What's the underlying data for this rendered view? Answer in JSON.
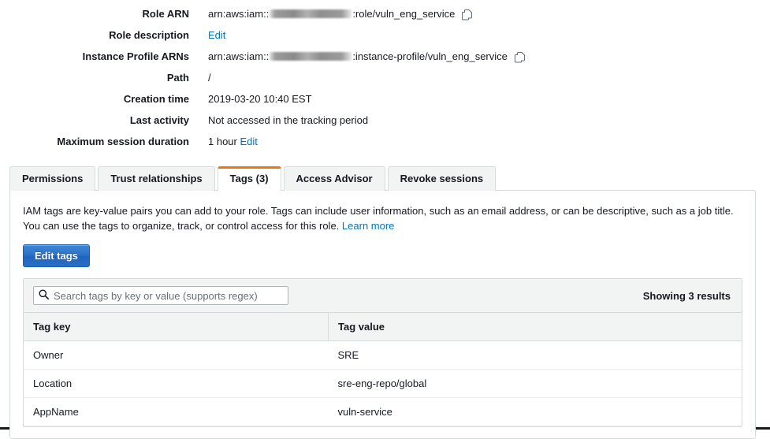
{
  "details": [
    {
      "label": "Role ARN",
      "prefix": "arn:aws:iam::",
      "redacted": true,
      "suffix": ":role/vuln_eng_service",
      "copy_icon": "copy-icon",
      "type": "arn"
    },
    {
      "label": "Role description",
      "link": "Edit",
      "type": "link"
    },
    {
      "label": "Instance Profile ARNs",
      "prefix": "arn:aws:iam::",
      "redacted": true,
      "suffix": ":instance-profile/vuln_eng_service",
      "copy_icon": "copy-icon",
      "type": "arn"
    },
    {
      "label": "Path",
      "value": "/",
      "type": "text"
    },
    {
      "label": "Creation time",
      "value": "2019-03-20 10:40 EST",
      "type": "text"
    },
    {
      "label": "Last activity",
      "value": "Not accessed in the tracking period",
      "type": "text"
    },
    {
      "label": "Maximum session duration",
      "value": "1 hour",
      "link": "Edit",
      "type": "text-link"
    }
  ],
  "tabs": [
    {
      "label": "Permissions",
      "active": false
    },
    {
      "label": "Trust relationships",
      "active": false
    },
    {
      "label": "Tags (3)",
      "active": true
    },
    {
      "label": "Access Advisor",
      "active": false
    },
    {
      "label": "Revoke sessions",
      "active": false
    }
  ],
  "panel": {
    "description": "IAM tags are key-value pairs you can add to your role. Tags can include user information, such as an email address, or can be descriptive, such as a job title. You can use the tags to organize, track, or control access for this role.",
    "learn_more": "Learn more",
    "edit_tags_button": "Edit tags"
  },
  "search": {
    "placeholder": "Search tags by key or value (supports regex)",
    "value": "",
    "icon": "search-icon"
  },
  "results_count": "Showing 3 results",
  "table": {
    "columns": [
      "Tag key",
      "Tag value"
    ],
    "rows": [
      {
        "key": "Owner",
        "value": "SRE"
      },
      {
        "key": "Location",
        "value": "sre-eng-repo/global"
      },
      {
        "key": "AppName",
        "value": "vuln-service"
      }
    ]
  },
  "colors": {
    "accent_orange": "#ec7211",
    "link_blue": "#0073bb",
    "button_blue": "#2a6fc6",
    "border_gray": "#d5dbdb",
    "panel_gray": "#f2f3f3"
  }
}
